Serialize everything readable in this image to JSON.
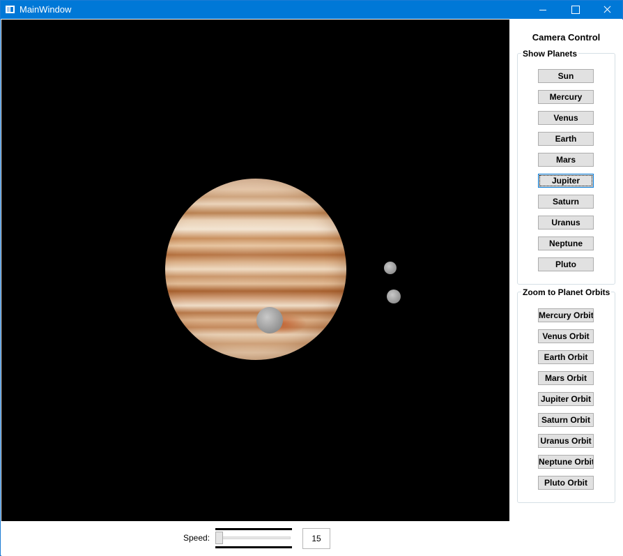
{
  "window": {
    "title": "MainWindow",
    "controls": [
      "minimize-icon",
      "maximize-icon",
      "close-icon"
    ],
    "accent_color": "#0078d7"
  },
  "scene": {
    "background_color": "#000000",
    "planet": "Jupiter",
    "moon_count": 3
  },
  "sidebar": {
    "header": "Camera Control",
    "show_planets": {
      "legend": "Show Planets",
      "buttons": [
        "Sun",
        "Mercury",
        "Venus",
        "Earth",
        "Mars",
        "Jupiter",
        "Saturn",
        "Uranus",
        "Neptune",
        "Pluto"
      ],
      "focused": "Jupiter"
    },
    "zoom_orbits": {
      "legend": "Zoom to Planet Orbits",
      "buttons": [
        "Mercury Orbit",
        "Venus Orbit",
        "Earth Orbit",
        "Mars Orbit",
        "Jupiter Orbit",
        "Saturn Orbit",
        "Uranus Orbit",
        "Neptune Orbit",
        "Pluto Orbit"
      ]
    }
  },
  "footer": {
    "speed_label": "Speed:",
    "speed_value": "15",
    "slider_position_fraction": 0.0
  }
}
